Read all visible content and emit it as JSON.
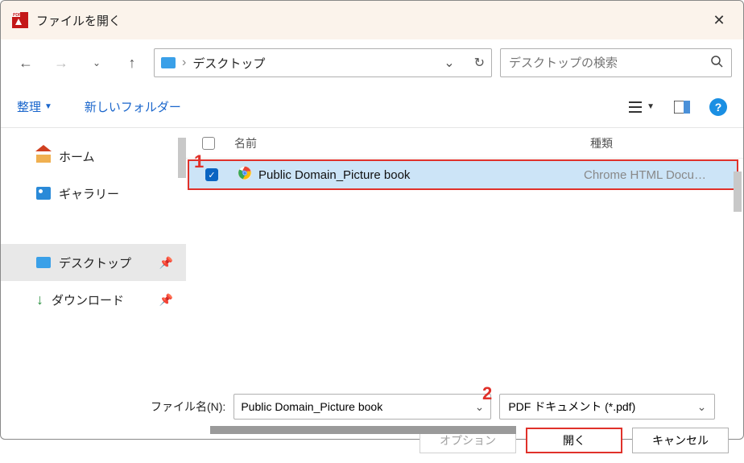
{
  "title": "ファイルを開く",
  "path": {
    "segment": "デスクトップ"
  },
  "search": {
    "placeholder": "デスクトップの検索"
  },
  "toolbar": {
    "organize": "整理",
    "newfolder": "新しいフォルダー"
  },
  "sidebar": {
    "home": "ホーム",
    "gallery": "ギャラリー",
    "desktop": "デスクトップ",
    "downloads": "ダウンロード"
  },
  "columns": {
    "name": "名前",
    "type": "種類"
  },
  "file": {
    "name": "Public Domain_Picture book",
    "type": "Chrome HTML Docu…"
  },
  "callouts": {
    "one": "1",
    "two": "2"
  },
  "footer": {
    "filename_label": "ファイル名(N):",
    "filename_value": "Public Domain_Picture book",
    "filter": "PDF ドキュメント (*.pdf)",
    "options": "オプション",
    "open": "開く",
    "cancel": "キャンセル"
  }
}
